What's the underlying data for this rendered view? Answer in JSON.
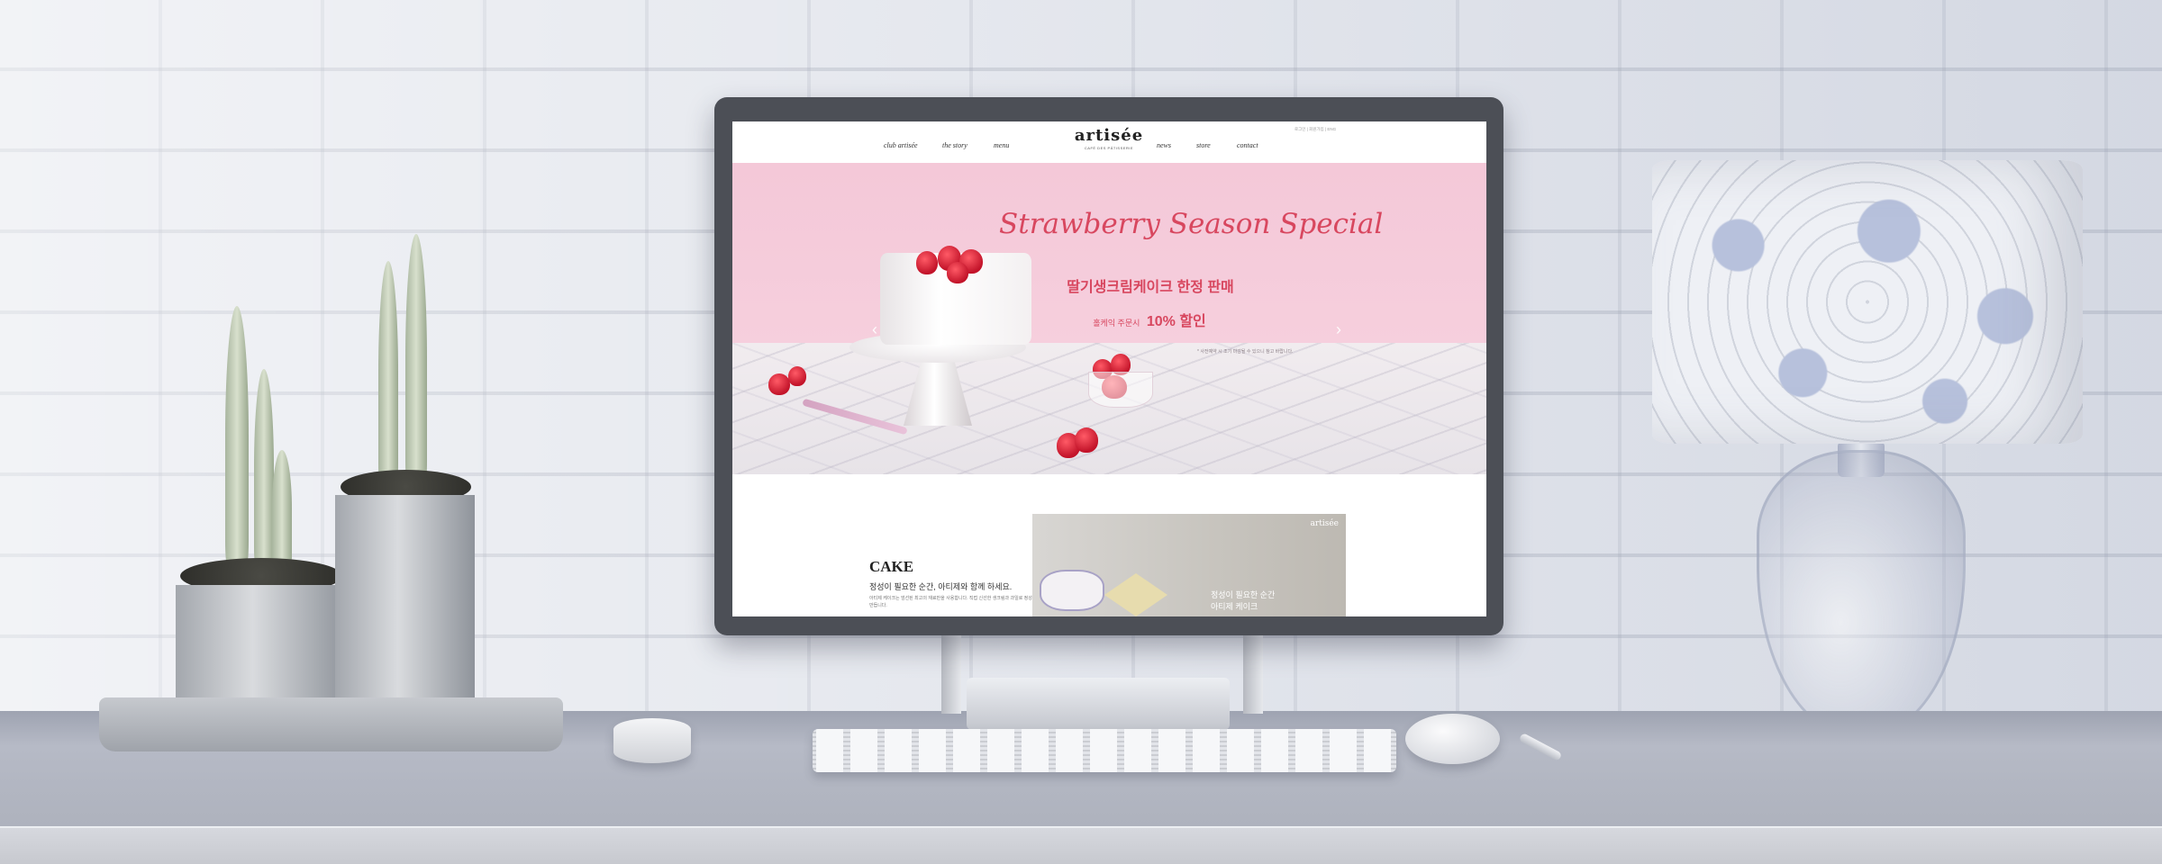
{
  "site": {
    "nav_left": [
      "club artisée",
      "the story",
      "menu"
    ],
    "nav_right": [
      "news",
      "store",
      "contact"
    ],
    "logo": "artisée",
    "logo_sub": "CAFÉ DES PÂTISSERIE",
    "util_links": "로그인 | 회원가입 | ENG",
    "hero": {
      "title": "Strawberry Season Special",
      "subtitle": "딸기생크림케이크 한정 판매",
      "discount_prefix": "홀케익 주문시",
      "discount_value": "10% 할인",
      "note": "* 사전예약 시 조기 마감될 수 있으니 참고 바랍니다.",
      "prev_label": "‹",
      "next_label": "›"
    },
    "cake_section": {
      "heading": "CAKE",
      "subheading": "정성이 필요한 순간, 아티제와 함께 하세요.",
      "description": "아티제 케이크는 엄선된 최고의 재료만을 사용합니다. 직접 신선한 생크림과 과일로 정성껏 만듭니다.",
      "image_logo": "artisée",
      "image_caption_1": "정성이 필요한 순간",
      "image_caption_2": "아티제 케이크"
    }
  },
  "colors": {
    "accent": "#d8475f",
    "hero_pink": "#f6cfdd"
  }
}
